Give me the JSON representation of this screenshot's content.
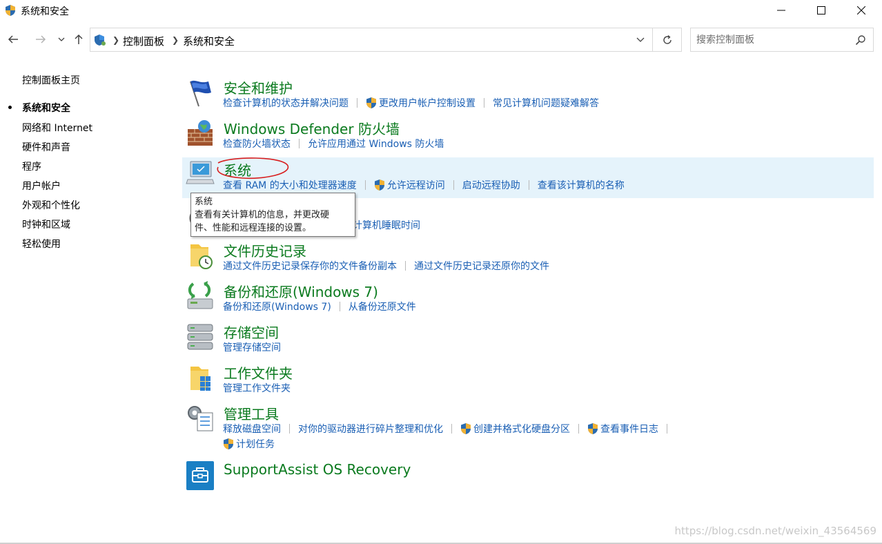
{
  "window": {
    "title": "系统和安全",
    "controls": [
      "minimize",
      "maximize",
      "close"
    ]
  },
  "address": {
    "breadcrumbs": [
      "控制面板",
      "系统和安全"
    ],
    "search_placeholder": "搜索控制面板"
  },
  "left_nav": {
    "home": "控制面板主页",
    "items": [
      {
        "label": "系统和安全",
        "current": true
      },
      {
        "label": "网络和 Internet"
      },
      {
        "label": "硬件和声音"
      },
      {
        "label": "程序"
      },
      {
        "label": "用户帐户"
      },
      {
        "label": "外观和个性化"
      },
      {
        "label": "时钟和区域"
      },
      {
        "label": "轻松使用"
      }
    ]
  },
  "categories": [
    {
      "title": "安全和维护",
      "icon": "flag-icon",
      "links": [
        "检查计算机的状态并解决问题",
        "更改用户帐户控制设置",
        "常见计算机问题疑难解答"
      ]
    },
    {
      "title": "Windows Defender 防火墙",
      "icon": "firewall-icon",
      "links": [
        "检查防火墙状态",
        "允许应用通过 Windows 防火墙"
      ]
    },
    {
      "title": "系统",
      "icon": "computer-icon",
      "links": [
        "查看 RAM 的大小和处理器速度",
        "允许远程访问",
        "启动远程协助",
        "查看该计算机的名称"
      ]
    },
    {
      "title": "",
      "icon": "power-icon",
      "links": [
        "计算机睡眠时间"
      ]
    },
    {
      "title": "文件历史记录",
      "icon": "file-history-icon",
      "links": [
        "通过文件历史记录保存你的文件备份副本",
        "通过文件历史记录还原你的文件"
      ]
    },
    {
      "title": "备份和还原(Windows 7)",
      "icon": "backup-icon",
      "links": [
        "备份和还原(Windows 7)",
        "从备份还原文件"
      ]
    },
    {
      "title": "存储空间",
      "icon": "storage-icon",
      "links": [
        "管理存储空间"
      ]
    },
    {
      "title": "工作文件夹",
      "icon": "work-folders-icon",
      "links": [
        "管理工作文件夹"
      ]
    },
    {
      "title": "管理工具",
      "icon": "admin-tools-icon",
      "links": [
        "释放磁盘空间",
        "对你的驱动器进行碎片整理和优化",
        "创建并格式化硬盘分区",
        "查看事件日志",
        "计划任务"
      ]
    },
    {
      "title": "SupportAssist OS Recovery",
      "icon": "supportassist-icon",
      "links": []
    }
  ],
  "tooltip": {
    "title": "系统",
    "line1": "查看有关计算机的信息，并更改硬",
    "line2": "件、性能和远程连接的设置。"
  },
  "watermark": "https://blog.csdn.net/weixin_43564569",
  "colors": {
    "title_green": "#0a7a1e",
    "link_blue": "#1a5fb4",
    "hover_bg": "#e5f3fb",
    "annotation_red": "#d81e1e"
  }
}
